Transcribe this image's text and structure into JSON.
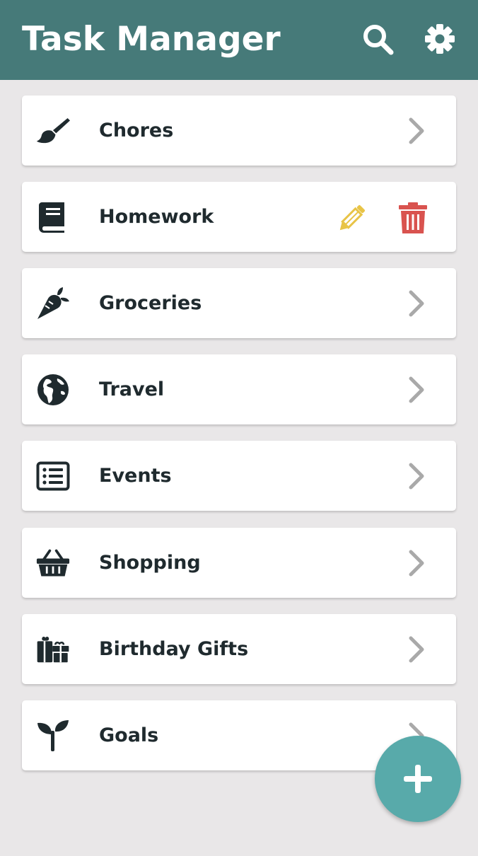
{
  "header": {
    "title": "Task Manager",
    "search_icon": "search-icon",
    "settings_icon": "gear-icon",
    "background": "#467a79"
  },
  "lists": [
    {
      "label": "Chores",
      "icon": "paint-brush-icon",
      "trailing": "chevron-right-icon"
    },
    {
      "label": "Homework",
      "icon": "book-icon",
      "trailing": "edit-delete"
    },
    {
      "label": "Groceries",
      "icon": "carrot-icon",
      "trailing": "chevron-right-icon"
    },
    {
      "label": "Travel",
      "icon": "globe-icon",
      "trailing": "chevron-right-icon"
    },
    {
      "label": "Events",
      "icon": "list-alt-icon",
      "trailing": "chevron-right-icon"
    },
    {
      "label": "Shopping",
      "icon": "shopping-basket-icon",
      "trailing": "chevron-right-icon"
    },
    {
      "label": "Birthday Gifts",
      "icon": "gifts-icon",
      "trailing": "chevron-right-icon"
    },
    {
      "label": "Goals",
      "icon": "seedling-icon",
      "trailing": "chevron-right-icon"
    }
  ],
  "actions": {
    "edit_icon": "pencil-icon",
    "edit_color": "#e8c447",
    "delete_icon": "trash-icon",
    "delete_color": "#d9534f"
  },
  "fab": {
    "icon": "plus-icon",
    "color": "#58aaaa"
  },
  "colors": {
    "background": "#e9e7e8",
    "card": "#ffffff",
    "text": "#1f2a2e",
    "chevron": "#a9a9a9"
  }
}
